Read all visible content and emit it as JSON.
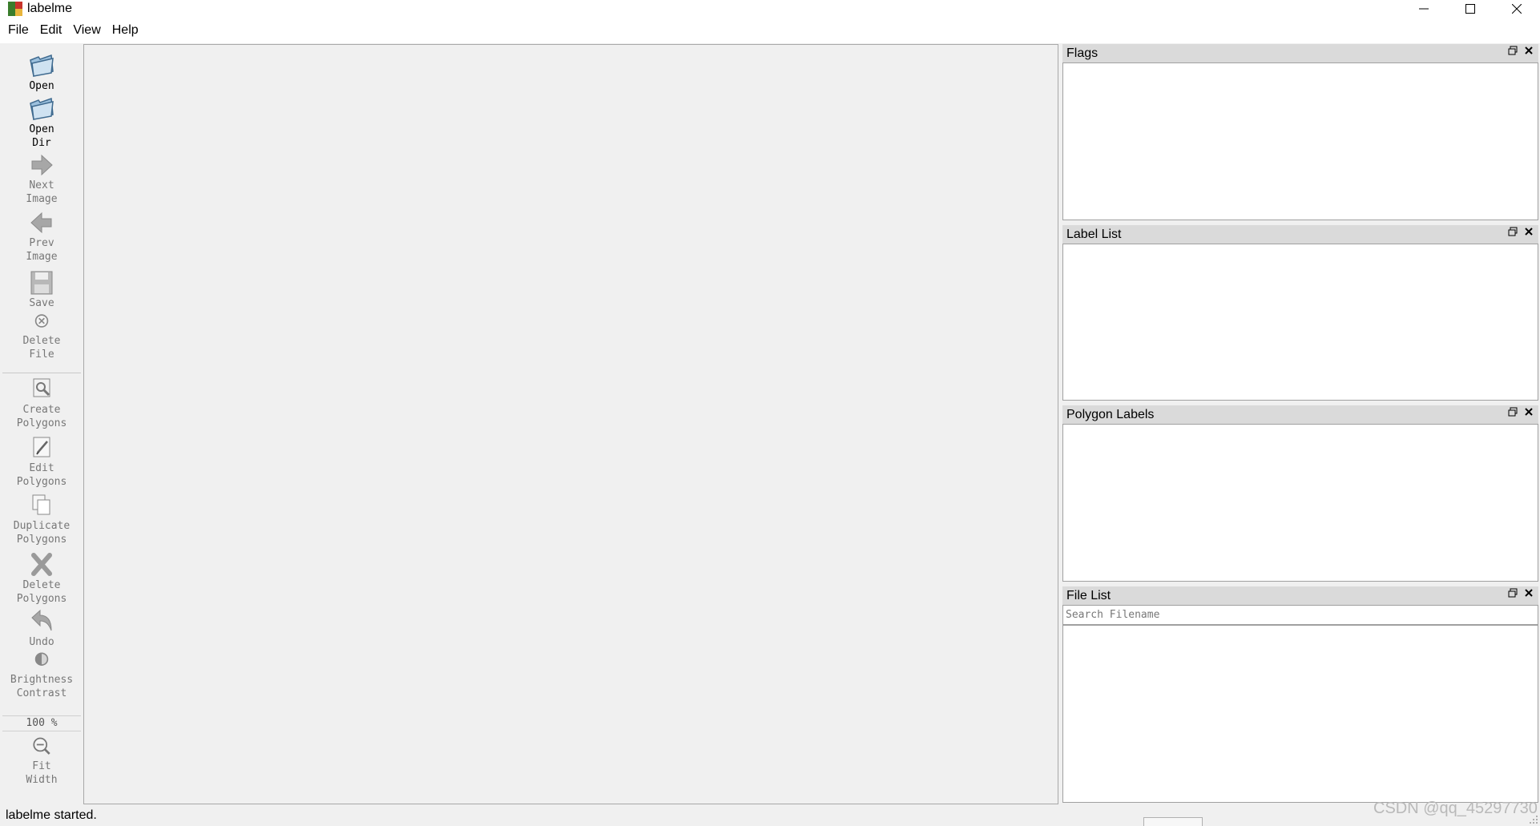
{
  "window": {
    "title": "labelme",
    "minimize_glyph": "—",
    "maximize_glyph": "☐",
    "close_glyph": "✕"
  },
  "menu": [
    "File",
    "Edit",
    "View",
    "Help"
  ],
  "toolbar": {
    "open": {
      "line1": "Open",
      "line2": ""
    },
    "open_dir": {
      "line1": "Open",
      "line2": "Dir"
    },
    "next_image": {
      "line1": "Next",
      "line2": "Image"
    },
    "prev_image": {
      "line1": "Prev",
      "line2": "Image"
    },
    "save": {
      "line1": "Save",
      "line2": ""
    },
    "delete_file": {
      "line1": "Delete",
      "line2": "File"
    },
    "create_polygons": {
      "line1": "Create",
      "line2": "Polygons"
    },
    "edit_polygons": {
      "line1": "Edit",
      "line2": "Polygons"
    },
    "duplicate_polygons": {
      "line1": "Duplicate",
      "line2": "Polygons"
    },
    "delete_polygons": {
      "line1": "Delete",
      "line2": "Polygons"
    },
    "undo": {
      "line1": "Undo",
      "line2": ""
    },
    "brightness_contrast": {
      "line1": "Brightness",
      "line2": "Contrast"
    },
    "zoom": "100 %",
    "fit_width": {
      "line1": "Fit",
      "line2": "Width"
    }
  },
  "docks": {
    "flags": {
      "title": "Flags"
    },
    "label_list": {
      "title": "Label List"
    },
    "polygon_labels": {
      "title": "Polygon Labels"
    },
    "file_list": {
      "title": "File List",
      "search_placeholder": "Search Filename"
    }
  },
  "status": {
    "message": "labelme started."
  },
  "watermark": "CSDN @qq_45297730",
  "colors": {
    "chrome": "#f0f0f0",
    "dock_header": "#dadada",
    "panel": "#ffffff"
  }
}
